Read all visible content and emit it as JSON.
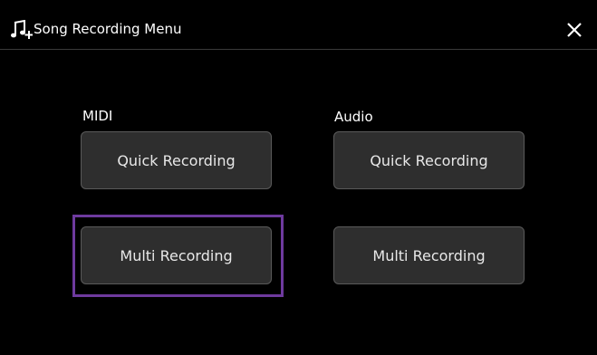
{
  "header": {
    "title": "Song Recording Menu",
    "icon": "song-recording-icon",
    "close_icon": "close-icon"
  },
  "midi": {
    "label": "MIDI",
    "quick_recording_label": "Quick Recording",
    "multi_recording_label": "Multi Recording"
  },
  "audio": {
    "label": "Audio",
    "quick_recording_label": "Quick Recording",
    "multi_recording_label": "Multi Recording"
  },
  "colors": {
    "background": "#000000",
    "button_bg": "#2e2e2e",
    "button_border": "#5a5a5a",
    "focus_outline": "#6e3a9e",
    "text": "#ffffff"
  }
}
